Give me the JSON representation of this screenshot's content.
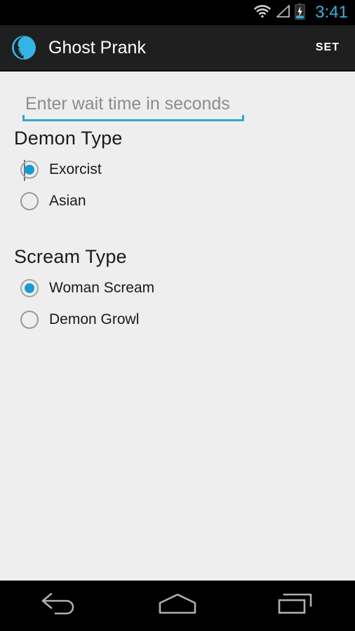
{
  "status_bar": {
    "time": "3:41",
    "icons": [
      "wifi-icon",
      "signal-icon",
      "battery-charging-icon"
    ],
    "clock_color": "#33b5e5",
    "background": "#000000"
  },
  "action_bar": {
    "app_icon": "ghost-app-icon",
    "title": "Ghost Prank",
    "set_label": "SET",
    "background": "#1f1f1f",
    "accent": "#33b5e5"
  },
  "form": {
    "wait_time": {
      "label": "wait-time-input",
      "value": "",
      "placeholder": "Enter wait time in seconds",
      "underline_color": "#33a5d0"
    },
    "sections": [
      {
        "title": "Demon Type",
        "options": [
          {
            "label": "Exorcist",
            "selected": true
          },
          {
            "label": "Asian",
            "selected": false
          }
        ]
      },
      {
        "title": "Scream Type",
        "options": [
          {
            "label": "Woman Scream",
            "selected": true
          },
          {
            "label": "Demon Growl",
            "selected": false
          }
        ]
      }
    ],
    "selected_color": "#179bd5",
    "background": "#eeeeee"
  },
  "nav_bar": {
    "buttons": [
      {
        "name": "back-button",
        "icon": "back-arrow-icon"
      },
      {
        "name": "home-button",
        "icon": "home-icon"
      },
      {
        "name": "recents-button",
        "icon": "recents-icon"
      }
    ],
    "background": "#000000",
    "icon_color": "#b0b0b0"
  }
}
